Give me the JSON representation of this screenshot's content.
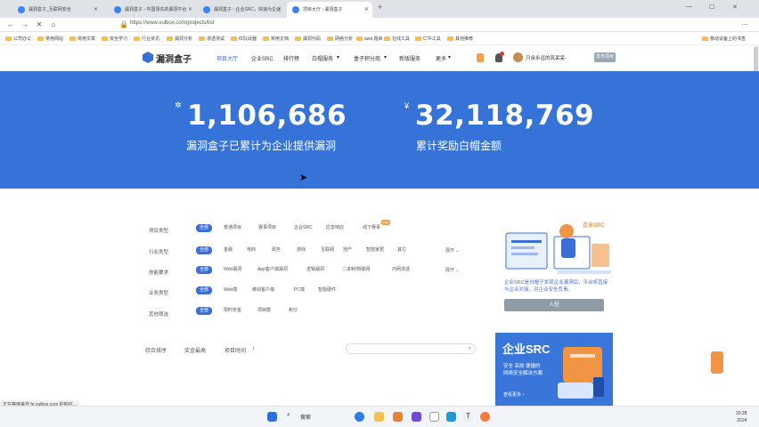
{
  "browser": {
    "tabs": [
      {
        "label": "漏洞盒子_互联网安全"
      },
      {
        "label": "漏洞盒子 - 中国领先的漏洞平台"
      },
      {
        "label": "漏洞盒子 - 企业SRC，快速为企业"
      },
      {
        "label": "项目大厅 - 漏洞盒子"
      }
    ],
    "url": "https://www.vulbox.com/projects/list",
    "bookmarks": [
      "公司办公",
      "常用网站",
      "常用文章",
      "安全学习",
      "行业资讯",
      "漏洞分析",
      "渗透测试",
      "红队武器",
      "常用文档",
      "漏洞代码",
      "网络分析",
      "awd 题目",
      "在线工具",
      "CTF工具",
      "其他推荐"
    ],
    "bookmarks_right": "移动设备上的书签"
  },
  "site": {
    "logo": "漏洞盒子",
    "nav": [
      "项目大厅",
      "企业SRC",
      "排行榜",
      "白帽服务",
      "盒子积分商",
      "新版服务",
      "更多"
    ],
    "username": "只余永远的风呆呆-",
    "publish": "发布项目"
  },
  "hero": {
    "left_number": "1,106,686",
    "left_caption": "漏洞盒子已累计为企业提供漏洞",
    "right_currency": "¥",
    "right_number": "32,118,769",
    "right_caption": "累计奖励白帽金额"
  },
  "filters": [
    {
      "label": "项目类型",
      "selected": "全部",
      "options": [
        "普通项目",
        "赛事项目",
        "企业SRC",
        "应急响应",
        "线下赛事"
      ],
      "more": ""
    },
    {
      "label": "行业类型",
      "selected": "全部",
      "options": [
        "金融",
        "电商",
        "政务",
        "游戏",
        "互联网",
        "地产",
        "智能家居",
        "其它"
      ],
      "more": "展开"
    },
    {
      "label": "技能要求",
      "selected": "全部",
      "options": [
        "Web漏洞",
        "App客户端漏洞",
        "逻辑漏洞",
        "二进制/物联网",
        "内网渗透"
      ],
      "more": "展开"
    },
    {
      "label": "业务类型",
      "selected": "全部",
      "options": [
        "Web端",
        "移动客户端",
        "PC端",
        "智能硬件"
      ],
      "more": ""
    },
    {
      "label": "其他筛选",
      "selected": "全部",
      "options": [
        "限时奖金",
        "项目群",
        "积分"
      ],
      "more": ""
    }
  ],
  "hot_badge": "hot",
  "promo": {
    "title_badge": "企业SRC",
    "description": "企业SRC是白帽子发现企业漏洞后，平台将直接与企业对接，对企业安全负责。",
    "button": "入驻"
  },
  "sort": {
    "items": [
      "综合排序",
      "奖金最高",
      "项目时间"
    ],
    "search_placeholder": ""
  },
  "bottom_card": {
    "title": "企业SRC",
    "line1": "安全 高效 便捷的",
    "line2": "网络安全解决方案",
    "link": "查看更多 ›"
  },
  "status": "正在等待来自 fe.vulbox.com 的响应...",
  "taskbar": {
    "search": "搜索",
    "time": "20:28",
    "date": "2024"
  },
  "colors": {
    "brand_blue": "#3673d8",
    "accent_orange": "#f19444"
  }
}
